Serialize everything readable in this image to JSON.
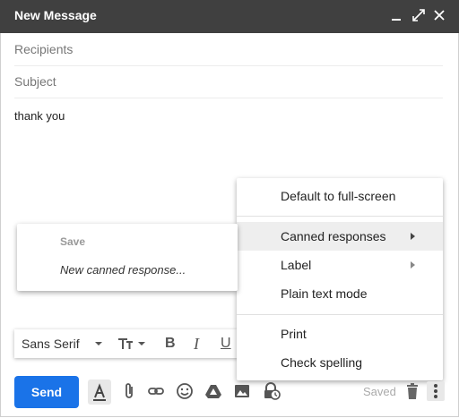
{
  "window": {
    "title": "New Message"
  },
  "fields": {
    "recipients_placeholder": "Recipients",
    "subject_placeholder": "Subject"
  },
  "message": {
    "body": "thank you"
  },
  "menu": {
    "items": [
      {
        "label": "Default to full-screen"
      },
      {
        "label": "Canned responses",
        "submenu": true
      },
      {
        "label": "Label",
        "submenu": true
      },
      {
        "label": "Plain text mode"
      },
      {
        "label": "Print"
      },
      {
        "label": "Check spelling"
      }
    ]
  },
  "submenu": {
    "items": [
      {
        "label": "Save"
      },
      {
        "label": "New canned response..."
      }
    ]
  },
  "formatting": {
    "font": "Sans Serif",
    "bold": "B",
    "italic": "I",
    "underline": "U"
  },
  "footer": {
    "send_label": "Send",
    "status": "Saved"
  }
}
